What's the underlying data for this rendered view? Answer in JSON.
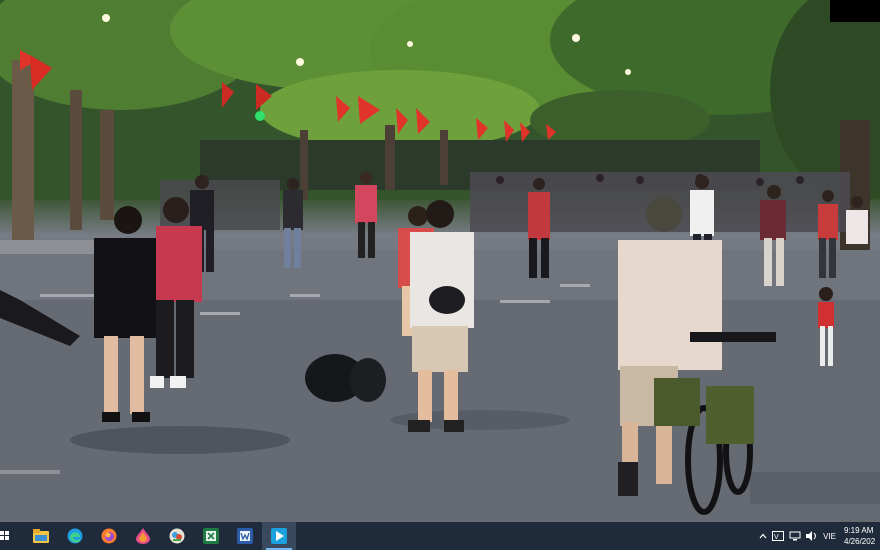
{
  "video": {
    "description_free": true
  },
  "taskbar": {
    "apps": [
      {
        "name": "file-explorer"
      },
      {
        "name": "edge"
      },
      {
        "name": "firefox"
      },
      {
        "name": "paint-3d"
      },
      {
        "name": "photo-viewer"
      },
      {
        "name": "excel"
      },
      {
        "name": "word"
      },
      {
        "name": "media-player",
        "active": true
      }
    ],
    "tray": {
      "language": "VIE",
      "time": "9:19 AM",
      "date": "4/26/202"
    },
    "colors": {
      "taskbar_bg": "#1f2b3a",
      "accent": "#7ab8f5"
    }
  }
}
